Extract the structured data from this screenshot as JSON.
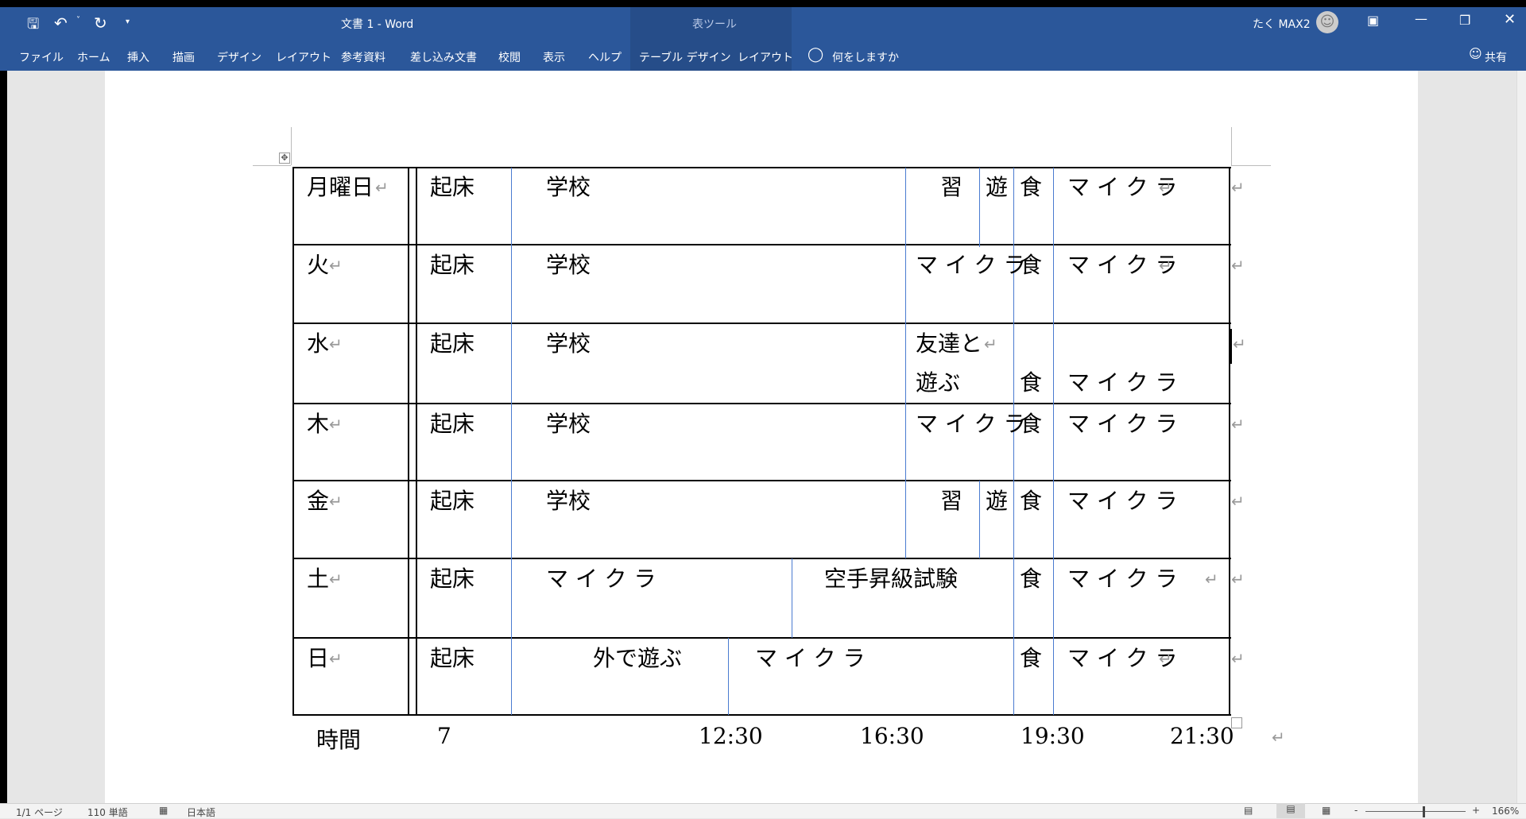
{
  "window": {
    "title": "文書 1  -  Word",
    "context_tab_group": "表ツール",
    "user": "たく MAX2"
  },
  "quick_access": [
    "save-icon",
    "undo-icon",
    "redo-icon",
    "customize-icon"
  ],
  "ribbon_tabs": [
    "ファイル",
    "ホーム",
    "挿入",
    "描画",
    "デザイン",
    "レイアウト",
    "参考資料",
    "差し込み文書",
    "校閲",
    "表示",
    "ヘルプ",
    "テーブル デザイン",
    "レイアウト"
  ],
  "tell_me": "何をしますか",
  "share": "共有",
  "table": {
    "rows": [
      {
        "day": "月曜日",
        "wake": "起床",
        "c1": "学校",
        "c2": "習",
        "c3": "遊",
        "meal": "食",
        "evening": "マイクラ"
      },
      {
        "day": "火",
        "wake": "起床",
        "c1": "学校",
        "c2": "マイクラ",
        "meal": "食",
        "evening": "マイクラ"
      },
      {
        "day": "水",
        "wake": "起床",
        "c1": "学校",
        "c2a": "友達と",
        "c2b": "遊ぶ",
        "meal": "食",
        "evening": "マイクラ"
      },
      {
        "day": "木",
        "wake": "起床",
        "c1": "学校",
        "c2": "マイクラ",
        "meal": "食",
        "evening": "マイクラ"
      },
      {
        "day": "金",
        "wake": "起床",
        "c1": "学校",
        "c2": "習",
        "c3": "遊",
        "meal": "食",
        "evening": "マイクラ"
      },
      {
        "day": "土",
        "wake": "起床",
        "c1": "マイクラ",
        "c2": "空手昇級試験",
        "meal": "食",
        "evening": "マイクラ"
      },
      {
        "day": "日",
        "wake": "起床",
        "c1": "外で遊ぶ",
        "c2": "マイクラ",
        "meal": "食",
        "evening": "マイクラ"
      }
    ],
    "time_row": [
      "時間",
      "7",
      "12:30",
      "16:30",
      "19:30",
      "21:30"
    ]
  },
  "paragraph_mark": "↵",
  "status": {
    "page": "1/1 ページ",
    "words": "110 単語",
    "language": "日本語",
    "zoom": "166%"
  }
}
